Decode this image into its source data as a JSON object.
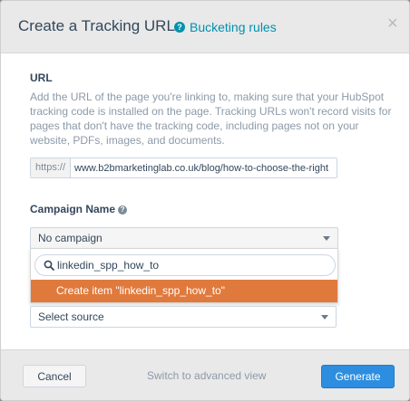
{
  "modal": {
    "title": "Create a Tracking URL",
    "help_link": "Bucketing rules",
    "close_symbol": "×"
  },
  "url_section": {
    "label": "URL",
    "description": "Add the URL of the page you're linking to, making sure that your HubSpot tracking code is installed on the page. Tracking URLs won't record visits for pages that don't have the tracking code, including pages not on your website, PDFs, images, and documents.",
    "prefix": "https://",
    "value": "www.b2bmarketinglab.co.uk/blog/how-to-choose-the-right"
  },
  "campaign": {
    "label": "Campaign Name",
    "selected": "No campaign",
    "search_value": "linkedin_spp_how_to",
    "create_option": "Create item \"linkedin_spp_how_to\""
  },
  "source": {
    "selected": "Select source"
  },
  "footer": {
    "cancel_label": "Cancel",
    "switch_label": "Switch to advanced view",
    "generate_label": "Generate"
  },
  "colors": {
    "accent_blue": "#2d8ee0",
    "link_blue": "#0091ae",
    "highlight_orange": "#e07a3c"
  }
}
